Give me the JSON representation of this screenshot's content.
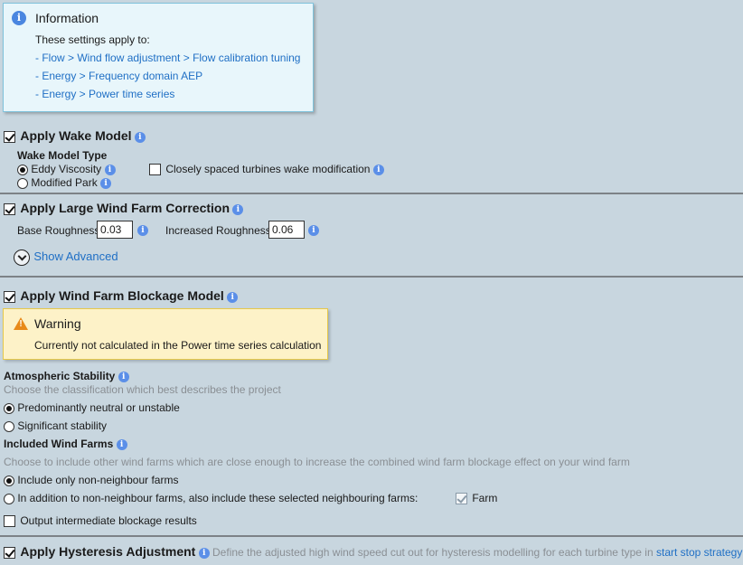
{
  "info_box": {
    "icon": "info-icon",
    "title": "Information",
    "subtitle": "These settings apply to:",
    "links": [
      "- Flow > Wind flow adjustment > Flow calibration tuning",
      "- Energy > Frequency domain AEP",
      "- Energy > Power time series"
    ]
  },
  "wake_model": {
    "checked": true,
    "title": "Apply Wake Model",
    "type_label": "Wake Model Type",
    "options": [
      {
        "label": "Eddy Viscosity",
        "selected": true
      },
      {
        "label": "Modified Park",
        "selected": false
      }
    ],
    "closely_spaced": {
      "label": "Closely spaced turbines wake modification",
      "checked": false
    }
  },
  "large_wind_farm": {
    "checked": true,
    "title": "Apply Large Wind Farm Correction",
    "base_roughness_label": "Base Roughness",
    "base_roughness_value": "0.03",
    "increased_roughness_label": "Increased Roughness",
    "increased_roughness_value": "0.06",
    "show_advanced": "Show Advanced"
  },
  "blockage": {
    "checked": true,
    "title": "Apply Wind Farm Blockage Model",
    "warning": {
      "icon": "warning-icon",
      "title": "Warning",
      "message": "Currently not calculated in the Power time series calculation"
    },
    "stability": {
      "title": "Atmospheric Stability",
      "description": "Choose the classification which best describes the project",
      "options": [
        {
          "label": "Predominantly neutral or unstable",
          "selected": true
        },
        {
          "label": "Significant stability",
          "selected": false
        }
      ]
    },
    "included_farms": {
      "title": "Included Wind Farms",
      "description": "Choose to include other wind farms which are close enough to increase the combined wind farm blockage effect on your wind farm",
      "options": [
        {
          "label": "Include only non-neighbour farms",
          "selected": true
        },
        {
          "label": "In addition to non-neighbour farms, also include these selected neighbouring farms:",
          "selected": false
        }
      ],
      "farm": {
        "label": "Farm",
        "checked": true
      }
    },
    "output_intermediate": {
      "label": "Output intermediate blockage results",
      "checked": false
    }
  },
  "hysteresis": {
    "checked": true,
    "title": "Apply Hysteresis Adjustment",
    "description": "Define the adjusted high wind speed cut out for hysteresis modelling for each turbine type in",
    "link": "start stop strategy"
  },
  "colors": {
    "background": "#c8d6df",
    "link": "#1f6fc5",
    "info_icon": "#5b8fe8",
    "info_box_bg": "#e8f6fb",
    "warning_bg": "#fdf2c8",
    "warning_icon": "#e88a1a"
  }
}
